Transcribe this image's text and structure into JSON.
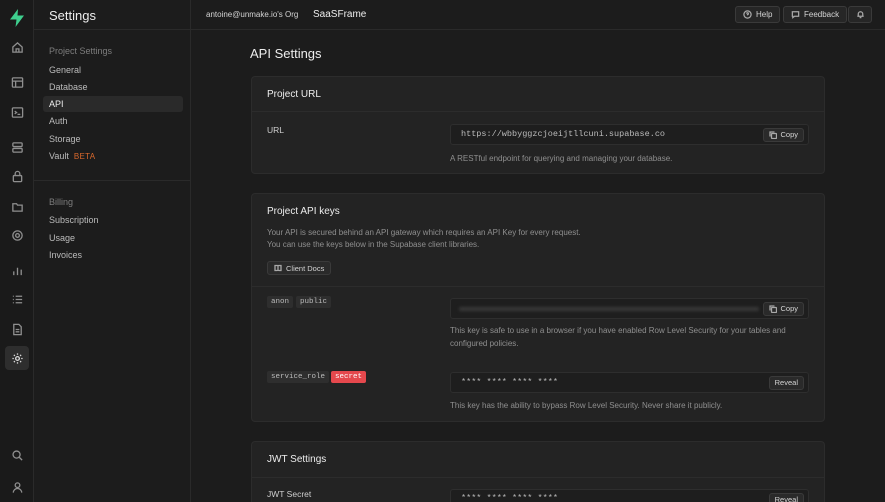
{
  "settings_title": "Settings",
  "project_settings": {
    "heading": "Project Settings",
    "items": [
      {
        "label": "General"
      },
      {
        "label": "Database"
      },
      {
        "label": "API"
      },
      {
        "label": "Auth"
      },
      {
        "label": "Storage"
      },
      {
        "label": "Vault",
        "badge": "BETA"
      }
    ]
  },
  "billing": {
    "heading": "Billing",
    "items": [
      {
        "label": "Subscription"
      },
      {
        "label": "Usage"
      },
      {
        "label": "Invoices"
      }
    ]
  },
  "topbar": {
    "org": "antoine@unmake.io's Org",
    "project": "SaaSFrame",
    "help": "Help",
    "feedback": "Feedback"
  },
  "page": {
    "title": "API Settings"
  },
  "project_url": {
    "title": "Project URL",
    "label": "URL",
    "value": "https://wbbyggzcjoeijtllcuni.supabase.co",
    "copy": "Copy",
    "help": "A RESTful endpoint for querying and managing your database."
  },
  "api_keys": {
    "title": "Project API keys",
    "description_1": "Your API is secured behind an API gateway which requires an API Key for every request.",
    "description_2": "You can use the keys below in the Supabase client libraries.",
    "docs_button": "Client Docs",
    "anon": {
      "tag1": "anon",
      "tag2": "public",
      "copy": "Copy",
      "help": "This key is safe to use in a browser if you have enabled Row Level Security for your tables and configured policies."
    },
    "service": {
      "tag1": "service_role",
      "tag2": "secret",
      "masked": "**** **** **** ****",
      "reveal": "Reveal",
      "help": "This key has the ability to bypass Row Level Security. Never share it publicly."
    }
  },
  "jwt": {
    "title": "JWT Settings",
    "label": "JWT Secret",
    "masked": "**** **** **** ****",
    "reveal": "Reveal"
  },
  "colors": {
    "brand": "#3ecf8e",
    "secret": "#e5484d",
    "beta": "#d9682c"
  }
}
